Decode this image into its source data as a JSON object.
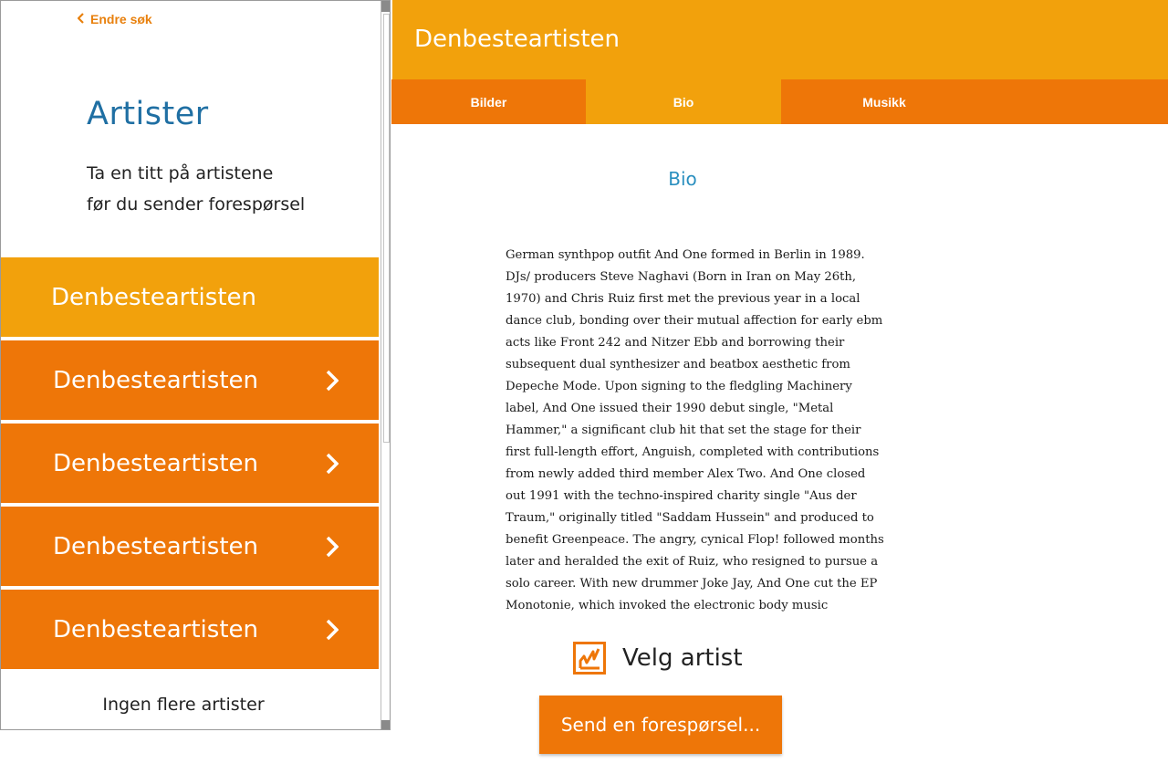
{
  "sidebar": {
    "back_link": "Endre søk",
    "title": "Artister",
    "description_line1": "Ta en titt på artistene",
    "description_line2": "før du sender forespørsel",
    "active_artist": "Denbesteartisten",
    "artists": [
      "Denbesteartisten",
      "Denbesteartisten",
      "Denbesteartisten",
      "Denbesteartisten"
    ],
    "footer_text": "Ingen flere artister"
  },
  "header": {
    "title": "Denbesteartisten"
  },
  "tabs": [
    {
      "label": "Bilder"
    },
    {
      "label": "Bio"
    },
    {
      "label": "Musikk"
    }
  ],
  "bio": {
    "heading": "Bio",
    "text": "German synthpop outfit And One formed in Berlin in 1989. DJs/ producers Steve Naghavi (Born in Iran on May 26th, 1970) and Chris Ruiz first met the previous year in a local dance club, bonding over their mutual affection for early ebm acts like Front 242 and Nitzer Ebb and borrowing their subsequent dual synthesizer and beatbox aesthetic from Depeche Mode. Upon signing to the fledgling Machinery label, And One issued their 1990 debut single, \"Metal Hammer,\" a significant club hit that set the stage for their first full-length effort, Anguish, completed with contributions from newly added third member Alex Two. And One closed out 1991 with the techno-inspired charity single \"Aus der Traum,\" originally titled \"Saddam Hussein\" and produced to benefit Greenpeace. The angry, cynical Flop! followed months later and heralded the exit of Ruiz, who resigned to pursue a solo career. With new drummer Joke Jay, And One cut the EP Monotonie, which invoked the electronic body music"
  },
  "select": {
    "label": "Velg artist"
  },
  "send_button": {
    "label": "Send en forespørsel..."
  },
  "colors": {
    "orange": "#ee7608",
    "amber": "#f2a10c",
    "blue": "#1f6fa3"
  }
}
